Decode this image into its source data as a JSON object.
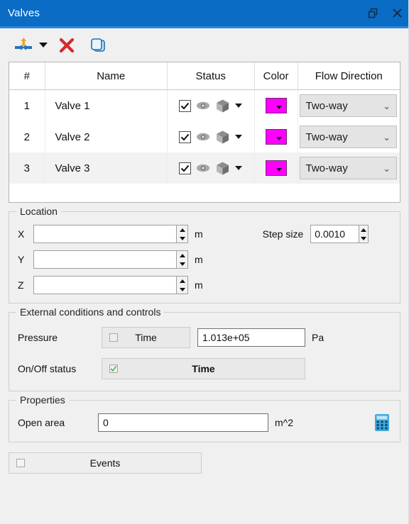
{
  "window": {
    "title": "Valves",
    "restore_icon": "restore-icon",
    "close_icon": "close-icon"
  },
  "toolbar": {
    "add_label": "Add valve",
    "add_icon": "add-valve-icon",
    "add_caret_icon": "chevron-down-icon",
    "delete_label": "Delete",
    "delete_icon": "delete-x-icon",
    "copy_label": "Copy",
    "copy_icon": "copy-pages-icon"
  },
  "table": {
    "columns": [
      "#",
      "Name",
      "Status",
      "Color",
      "Flow Direction"
    ],
    "rows": [
      {
        "num": "1",
        "name": "Valve 1",
        "checked": true,
        "eye_icon": "eye-icon",
        "cube_icon": "cube-icon",
        "caret_icon": "chevron-down-icon",
        "color": "#FF00FF",
        "flow": "Two-way",
        "selected": false
      },
      {
        "num": "2",
        "name": "Valve 2",
        "checked": true,
        "eye_icon": "eye-icon",
        "cube_icon": "cube-icon",
        "caret_icon": "chevron-down-icon",
        "color": "#FF00FF",
        "flow": "Two-way",
        "selected": false
      },
      {
        "num": "3",
        "name": "Valve 3",
        "checked": true,
        "eye_icon": "eye-icon",
        "cube_icon": "cube-icon",
        "caret_icon": "chevron-down-icon",
        "color": "#FF00FF",
        "flow": "Two-way",
        "selected": true
      }
    ]
  },
  "location": {
    "legend": "Location",
    "x_label": "X",
    "x_value": "",
    "y_label": "Y",
    "y_value": "",
    "z_label": "Z",
    "z_value": "",
    "unit": "m",
    "step_label": "Step size",
    "step_value": "0.0010"
  },
  "external": {
    "legend": "External conditions and controls",
    "pressure_label": "Pressure",
    "pressure_time_label": "Time",
    "pressure_time_checked": false,
    "pressure_value": "1.013e+05",
    "pressure_unit": "Pa",
    "onoff_label": "On/Off status",
    "onoff_time_label": "Time",
    "onoff_time_checked": true
  },
  "properties": {
    "legend": "Properties",
    "open_area_label": "Open area",
    "open_area_value": "0",
    "open_area_unit": "m^2",
    "calculator_icon": "calculator-icon"
  },
  "events": {
    "label": "Events",
    "checked": false
  },
  "colors": {
    "titlebar": "#0a6cc4",
    "titlebar_accent": "#2d87d8",
    "background": "#f0f0f0",
    "swatch": "#FF00FF",
    "check_green": "#3aa851",
    "delete_red": "#d42b2b"
  }
}
